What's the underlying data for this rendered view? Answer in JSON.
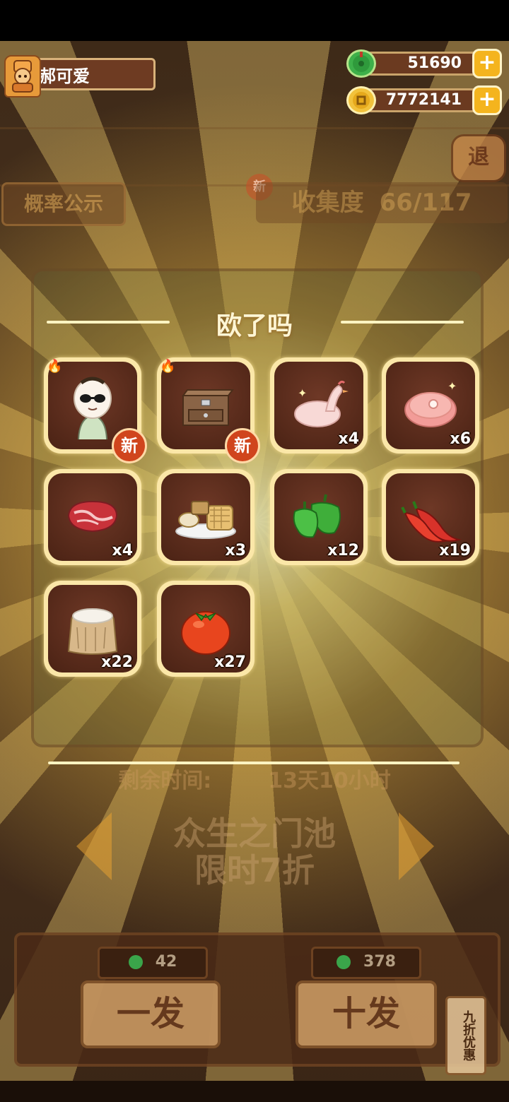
{
  "user": {
    "name": "郝可爱"
  },
  "currency": {
    "jade": {
      "amount": "51690",
      "icon": "jade-coin-icon"
    },
    "coin": {
      "amount": "7772141",
      "icon": "gold-coin-icon"
    },
    "plus_label": "+"
  },
  "header": {
    "exit_label": "退",
    "probability_label": "概率公示",
    "new_label": "新",
    "collection_label": "收集度",
    "collection_value": "66/117"
  },
  "modal": {
    "title": "欧了吗",
    "new_badge": "新",
    "items": [
      {
        "name": "character-sunglasses-baby",
        "qty": "",
        "is_new": true,
        "hot": true
      },
      {
        "name": "wooden-cabinet",
        "qty": "",
        "is_new": true,
        "hot": true
      },
      {
        "name": "chicken",
        "qty": "x4",
        "is_new": false,
        "hot": false
      },
      {
        "name": "ham",
        "qty": "x6",
        "is_new": false,
        "hot": false
      },
      {
        "name": "beef-steak",
        "qty": "x4",
        "is_new": false,
        "hot": false
      },
      {
        "name": "tofu-platter",
        "qty": "x3",
        "is_new": false,
        "hot": false
      },
      {
        "name": "green-pepper",
        "qty": "x12",
        "is_new": false,
        "hot": false
      },
      {
        "name": "chili-pepper",
        "qty": "x19",
        "is_new": false,
        "hot": false
      },
      {
        "name": "flour-sack",
        "qty": "x22",
        "is_new": false,
        "hot": false
      },
      {
        "name": "tomato",
        "qty": "x27",
        "is_new": false,
        "hot": false
      }
    ]
  },
  "background": {
    "remaining_label": "剩余时间:",
    "remaining_value": "13天10小时",
    "pool_line1": "众生之门池",
    "pool_line2": "限时7折",
    "single_cost": "42",
    "ten_cost": "378",
    "single_draw": "一发",
    "ten_draw": "十发",
    "discount": "九折优惠"
  },
  "colors": {
    "accent_gold": "#f4b41e",
    "card_frame": "#fbe7a8",
    "card_inner": "#4a2214",
    "new_badge": "#d0451d"
  }
}
